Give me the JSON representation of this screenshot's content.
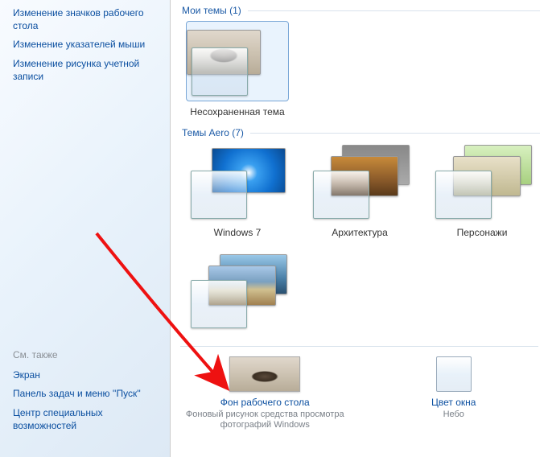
{
  "sidebar": {
    "top_links": [
      "Изменение значков рабочего стола",
      "Изменение указателей мыши",
      "Изменение рисунка учетной записи"
    ],
    "see_also": "См. также",
    "bottom_links": [
      "Экран",
      "Панель задач и меню ''Пуск''",
      "Центр специальных возможностей"
    ]
  },
  "sections": {
    "my_themes": {
      "label": "Мои темы (1)"
    },
    "aero": {
      "label": "Темы Aero (7)"
    }
  },
  "themes": {
    "unsaved": {
      "label": "Несохраненная тема"
    },
    "win7": {
      "label": "Windows 7"
    },
    "arch": {
      "label": "Архитектура"
    },
    "chars": {
      "label": "Персонажи"
    },
    "land": {
      "label": ""
    }
  },
  "bottom": {
    "bg": {
      "link": "Фон рабочего стола",
      "desc": "Фоновый рисунок средства просмотра фотографий Windows"
    },
    "color": {
      "link": "Цвет окна",
      "desc": "Небо"
    }
  },
  "colors": {
    "window_color": "#d9ecfb"
  }
}
